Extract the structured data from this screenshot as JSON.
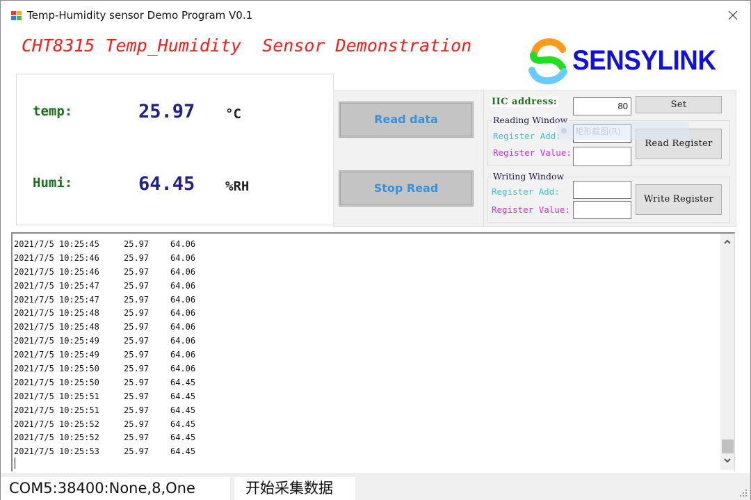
{
  "window": {
    "title": "Temp-Humidity sensor Demo Program V0.1",
    "close_icon": "close-icon"
  },
  "header": {
    "heading": "CHT8315 Temp_Humidity  Sensor Demonstration",
    "logo_text": "SENSYLINK",
    "colors": {
      "heading": "#ff1a1a",
      "logo_text": "#1010e0",
      "logo_orange": "#ff9a1a",
      "logo_green": "#22dd22",
      "logo_blue": "#66ccff"
    }
  },
  "readout": {
    "temp_label": "temp:",
    "temp_value": "25.97",
    "temp_unit": "°C",
    "humi_label": "Humi:",
    "humi_value": "64.45",
    "humi_unit": "%RH"
  },
  "controls": {
    "read_data_label": "Read data",
    "stop_read_label": "Stop Read",
    "iic_label": "IIC address:",
    "iic_value": "80",
    "set_label": "Set",
    "reading_window": {
      "title": "Reading Window",
      "reg_add_label": "Register Add:",
      "reg_value_label": "Register Value:",
      "reg_add_value": "",
      "reg_value_value": "",
      "button_label": "Read Register"
    },
    "writing_window": {
      "title": "Writing Window",
      "reg_add_label": "Register Add:",
      "reg_value_label": "Register Value:",
      "reg_add_value": "",
      "reg_value_value": "",
      "button_label": "Write Register"
    },
    "overlay_tooltip": "矩形截图(R)"
  },
  "log": {
    "rows": [
      {
        "time": "2021/7/5 10:25:45",
        "temp": "25.97",
        "humi": "64.06"
      },
      {
        "time": "2021/7/5 10:25:46",
        "temp": "25.97",
        "humi": "64.06"
      },
      {
        "time": "2021/7/5 10:25:46",
        "temp": "25.97",
        "humi": "64.06"
      },
      {
        "time": "2021/7/5 10:25:47",
        "temp": "25.97",
        "humi": "64.06"
      },
      {
        "time": "2021/7/5 10:25:47",
        "temp": "25.97",
        "humi": "64.06"
      },
      {
        "time": "2021/7/5 10:25:48",
        "temp": "25.97",
        "humi": "64.06"
      },
      {
        "time": "2021/7/5 10:25:48",
        "temp": "25.97",
        "humi": "64.06"
      },
      {
        "time": "2021/7/5 10:25:49",
        "temp": "25.97",
        "humi": "64.06"
      },
      {
        "time": "2021/7/5 10:25:49",
        "temp": "25.97",
        "humi": "64.06"
      },
      {
        "time": "2021/7/5 10:25:50",
        "temp": "25.97",
        "humi": "64.06"
      },
      {
        "time": "2021/7/5 10:25:50",
        "temp": "25.97",
        "humi": "64.45"
      },
      {
        "time": "2021/7/5 10:25:51",
        "temp": "25.97",
        "humi": "64.45"
      },
      {
        "time": "2021/7/5 10:25:51",
        "temp": "25.97",
        "humi": "64.45"
      },
      {
        "time": "2021/7/5 10:25:52",
        "temp": "25.97",
        "humi": "64.45"
      },
      {
        "time": "2021/7/5 10:25:52",
        "temp": "25.97",
        "humi": "64.45"
      },
      {
        "time": "2021/7/5 10:25:53",
        "temp": "25.97",
        "humi": "64.45"
      }
    ]
  },
  "statusbar": {
    "port": "COM5:38400:None,8,One",
    "message": "开始采集数据"
  }
}
